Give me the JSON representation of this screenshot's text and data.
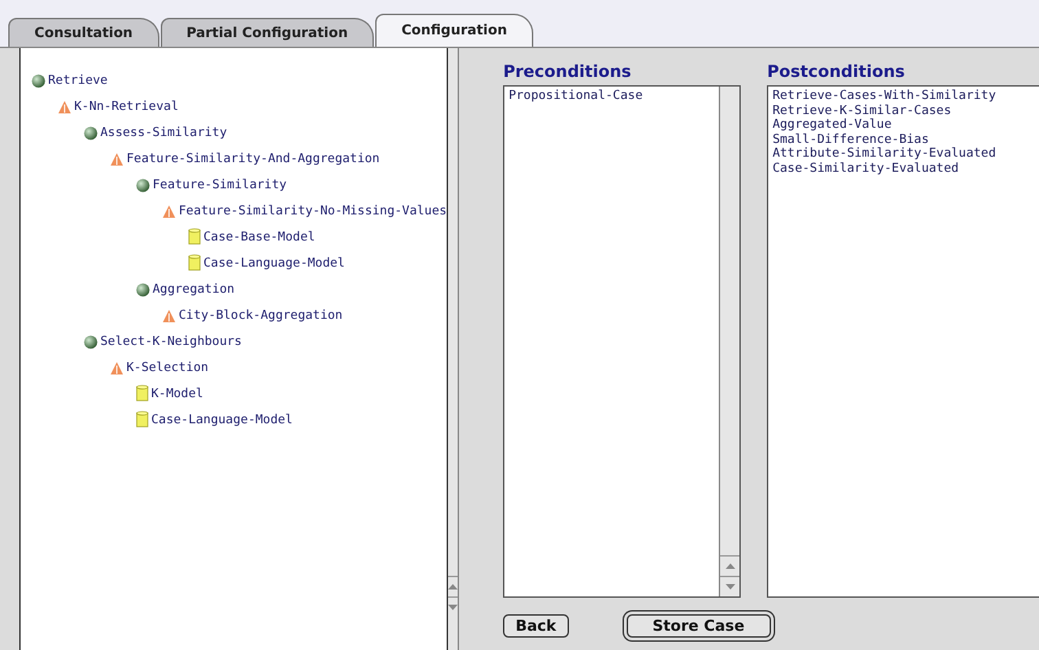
{
  "tabs": [
    {
      "label": "Consultation",
      "selected": false
    },
    {
      "label": "Partial Configuration",
      "selected": false
    },
    {
      "label": "Configuration",
      "selected": true
    }
  ],
  "tree": [
    {
      "label": "Retrieve",
      "kind": "task",
      "children": [
        {
          "label": "K-Nn-Retrieval",
          "kind": "method",
          "children": [
            {
              "label": "Assess-Similarity",
              "kind": "task",
              "children": [
                {
                  "label": "Feature-Similarity-And-Aggregation",
                  "kind": "method",
                  "children": [
                    {
                      "label": "Feature-Similarity",
                      "kind": "task",
                      "children": [
                        {
                          "label": "Feature-Similarity-No-Missing-Values",
                          "kind": "method",
                          "children": [
                            {
                              "label": "Case-Base-Model",
                              "kind": "model"
                            },
                            {
                              "label": "Case-Language-Model",
                              "kind": "model"
                            }
                          ]
                        }
                      ]
                    },
                    {
                      "label": "Aggregation",
                      "kind": "task",
                      "children": [
                        {
                          "label": "City-Block-Aggregation",
                          "kind": "method"
                        }
                      ]
                    }
                  ]
                }
              ]
            },
            {
              "label": "Select-K-Neighbours",
              "kind": "task",
              "children": [
                {
                  "label": "K-Selection",
                  "kind": "method",
                  "children": [
                    {
                      "label": "K-Model",
                      "kind": "model"
                    },
                    {
                      "label": "Case-Language-Model",
                      "kind": "model"
                    }
                  ]
                }
              ]
            }
          ]
        }
      ]
    }
  ],
  "preconditions": {
    "title": "Preconditions",
    "items": [
      "Propositional-Case"
    ]
  },
  "postconditions": {
    "title": "Postconditions",
    "items": [
      "Retrieve-Cases-With-Similarity",
      "Retrieve-K-Similar-Cases",
      "Aggregated-Value",
      "Small-Difference-Bias",
      "Attribute-Similarity-Evaluated",
      "Case-Similarity-Evaluated"
    ]
  },
  "buttons": [
    {
      "label": "Back",
      "kind": "plain"
    },
    {
      "label": "Store Case",
      "kind": "default"
    }
  ]
}
